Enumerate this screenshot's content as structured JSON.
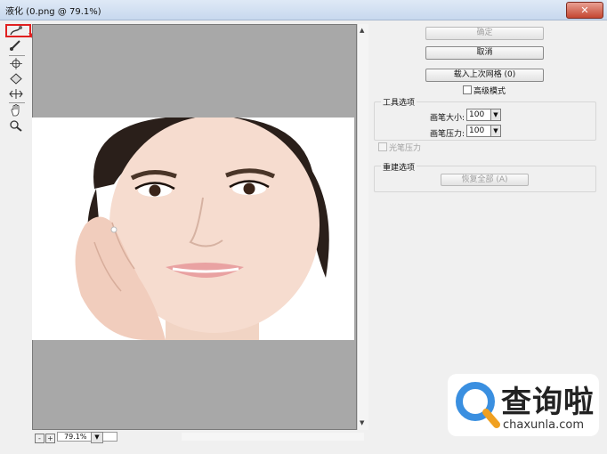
{
  "window": {
    "title": "液化 (0.png @ 79.1%)",
    "close_label": "✕"
  },
  "toolbar": {
    "tools": [
      {
        "icon": "forward-warp-icon",
        "glyph": "☝"
      },
      {
        "icon": "reconstruct-brush-icon",
        "glyph": "✎"
      },
      {
        "icon": "pucker-icon",
        "glyph": "✱"
      },
      {
        "icon": "bloat-icon",
        "glyph": "◆"
      },
      {
        "icon": "push-left-icon",
        "glyph": "⇹"
      },
      {
        "icon": "hand-icon",
        "glyph": "✋"
      },
      {
        "icon": "zoom-icon",
        "glyph": "🔍"
      }
    ]
  },
  "buttons": {
    "ok": "确定",
    "cancel": "取消",
    "load_mesh": "载入上次网格 (0)",
    "restore_all": "恢复全部 (A)"
  },
  "advanced_mode": {
    "label": "高级模式",
    "checked": false
  },
  "tool_options": {
    "title": "工具选项",
    "brush_size_label": "画笔大小:",
    "brush_size_value": "100",
    "brush_pressure_label": "画笔压力:",
    "brush_pressure_value": "100",
    "stylus_pressure_label": "光笔压力",
    "stylus_pressure_checked": false
  },
  "reconstruct_options": {
    "title": "重建选项"
  },
  "zoom": {
    "value": "79.1%",
    "minus": "-",
    "plus": "+"
  },
  "watermark": {
    "text": "查询啦",
    "sub": "chaxunla.com"
  },
  "colors": {
    "accent_red": "#e02020",
    "preview_gray": "#a8a8a8",
    "watermark_blue": "#3a8fe0"
  }
}
